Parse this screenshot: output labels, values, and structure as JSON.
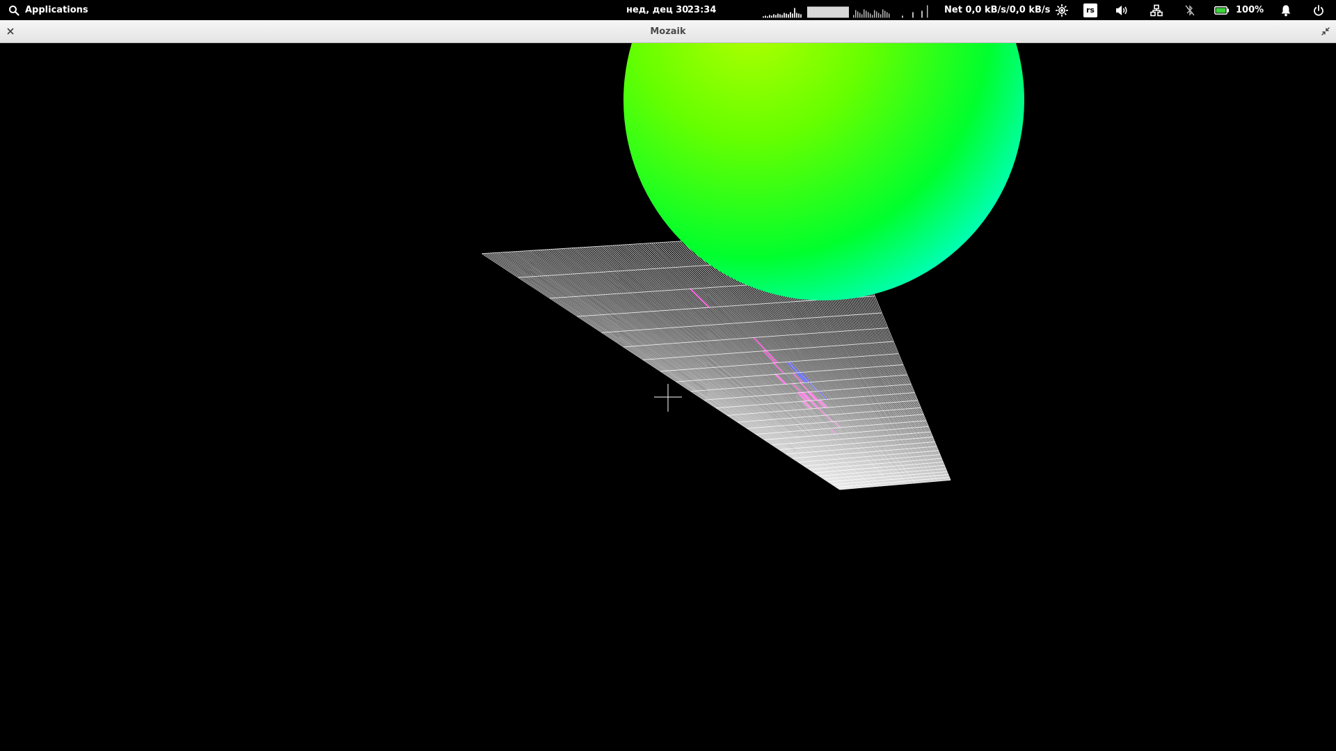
{
  "panel": {
    "applications_label": "Applications",
    "date": "нед, дец 30",
    "time": "23:34",
    "net_text": "Net 0,0 kB/s/0,0 kB/s",
    "keyboard_layout": "rs",
    "battery_percent": "100%",
    "battery_level": 1.0,
    "icons": {
      "search": "search-icon",
      "brightness": "brightness-icon",
      "volume": "volume-icon",
      "network": "network-icon",
      "bluetooth": "bluetooth-disabled-icon",
      "battery": "battery-icon",
      "notifications": "bell-icon",
      "power": "power-icon"
    }
  },
  "window": {
    "title": "Mozaik"
  },
  "scene": {
    "background": "#000000",
    "grid_color": "#ffffff",
    "tile_colors": {
      "magenta": "#ff00cc",
      "blue": "#0000ff"
    },
    "sphere_colors": [
      "#aaff00",
      "#00ff22",
      "#00ffff"
    ]
  }
}
